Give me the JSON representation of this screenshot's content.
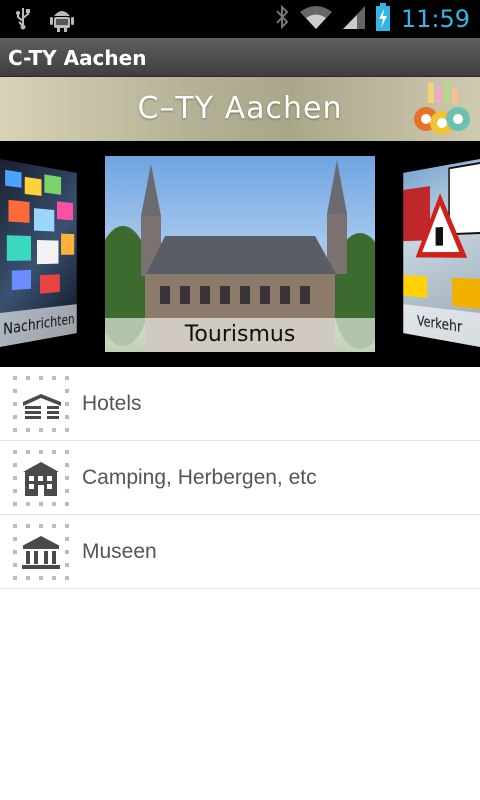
{
  "status_bar": {
    "time": "11:59",
    "icons": [
      "usb-icon",
      "android-debug-icon",
      "bluetooth-icon",
      "wifi-icon",
      "signal-icon",
      "battery-charging-icon"
    ],
    "accent": "#33b5e5"
  },
  "action_bar": {
    "title": "C-TY Aachen"
  },
  "banner": {
    "logo_text": "C–TY Aachen",
    "badge_icon": "city-pins-badge-icon"
  },
  "carousel": {
    "cards": [
      {
        "label": "Nachrichten",
        "image": "news-mosaic"
      },
      {
        "label": "Tourismus",
        "image": "aachen-town-hall"
      },
      {
        "label": "Verkehr",
        "image": "traffic-sign-collage"
      }
    ]
  },
  "list": {
    "items": [
      {
        "label": "Hotels",
        "icon": "hotel-icon"
      },
      {
        "label": "Camping, Herbergen, etc",
        "icon": "building-icon"
      },
      {
        "label": "Museen",
        "icon": "museum-icon"
      }
    ]
  }
}
